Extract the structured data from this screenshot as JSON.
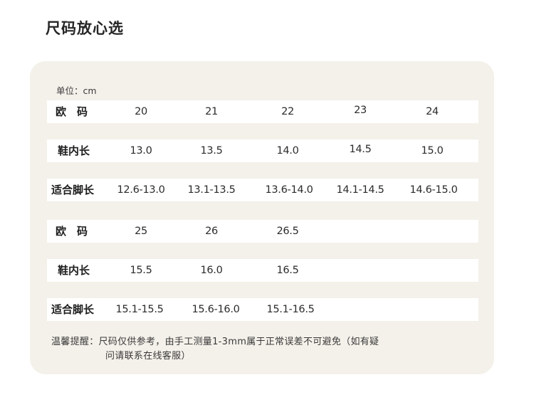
{
  "title": "尺码放心选",
  "unit_label": "单位：cm",
  "tables": [
    {
      "rows": [
        {
          "label": "欧　码",
          "values": [
            "20",
            "21",
            "22",
            "23",
            "24"
          ]
        },
        {
          "label": "鞋内长",
          "values": [
            "13.0",
            "13.5",
            "14.0",
            "14.5",
            "15.0"
          ]
        },
        {
          "label": "适合脚长",
          "values": [
            "12.6-13.0",
            "13.1-13.5",
            "13.6-14.0",
            "14.1-14.5",
            "14.6-15.0"
          ]
        }
      ]
    },
    {
      "rows": [
        {
          "label": "欧　码",
          "values": [
            "25",
            "26",
            "26.5"
          ]
        },
        {
          "label": "鞋内长",
          "values": [
            "15.5",
            "16.0",
            "16.5"
          ]
        },
        {
          "label": "适合脚长",
          "values": [
            "15.1-15.5",
            "15.6-16.0",
            "15.1-16.5"
          ]
        }
      ]
    }
  ],
  "note": {
    "line1": "温馨提醒：尺码仅供参考，由手工测量1-3mm属于正常误差不可避免（如有疑",
    "line2": "问请联系在线客服）"
  }
}
